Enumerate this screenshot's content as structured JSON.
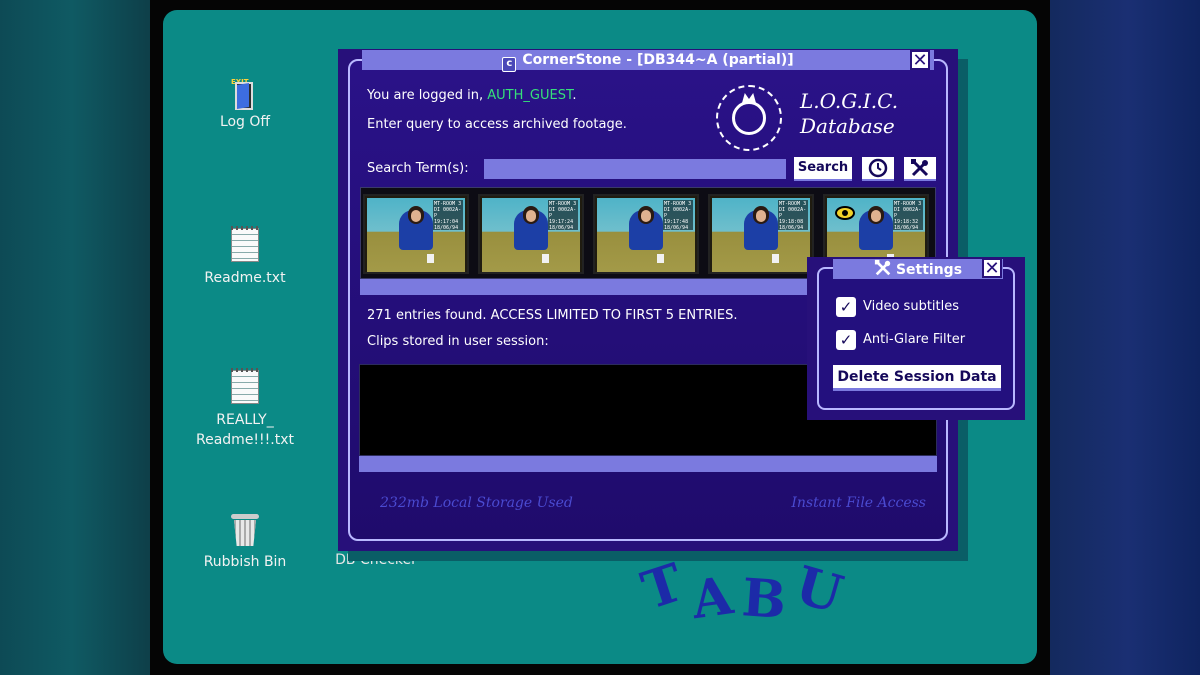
{
  "desktop": {
    "icons": [
      {
        "label": "Log Off",
        "icon": "exit-door-icon",
        "badge": "EXIT"
      },
      {
        "label": "Readme.txt",
        "icon": "notepad-icon"
      },
      {
        "label": "REALLY_",
        "label2": "Readme!!!.txt",
        "icon": "notepad-icon"
      },
      {
        "label": "Rubbish Bin",
        "icon": "trash-bin-icon"
      },
      {
        "label": "DB Checker",
        "icon": "none"
      }
    ],
    "background_text": "TABU"
  },
  "window": {
    "title": "CornerStone - [DB344~A (partial)]",
    "close_glyph": "✕",
    "logged_in_prefix": "You are logged in, ",
    "username": "AUTH_GUEST",
    "logged_in_suffix": ".",
    "instructions": "Enter query to access archived footage.",
    "logo_line1": "L.O.G.I.C.",
    "logo_line2": "Database",
    "search_label": "Search Term(s):",
    "search_value": "",
    "search_button": "Search",
    "results_text": "271 entries found. ACCESS LIMITED TO FIRST 5 ENTRIES.",
    "clips_label": "Clips stored in user session:",
    "storage_text": "232mb Local Storage Used",
    "access_text": "Instant File Access",
    "thumbnails": [
      {
        "stamp": "MT-ROOM 3 DI 0002A-P 19:17:04 18/06/94",
        "viewed": false
      },
      {
        "stamp": "MT-ROOM 3 DI 0002A-P 19:17:24 18/06/94",
        "viewed": false
      },
      {
        "stamp": "MT-ROOM 3 DI 0002A-P 19:17:48 18/06/94",
        "viewed": false
      },
      {
        "stamp": "MT-ROOM 3 DI 0002A-P 19:18:08 18/06/94",
        "viewed": false
      },
      {
        "stamp": "MT-ROOM 3 DI 0002A-P 19:18:32 18/06/94",
        "viewed": true
      }
    ]
  },
  "settings": {
    "title": "Settings",
    "close_glyph": "✕",
    "options": [
      {
        "label": "Video subtitles",
        "checked": true
      },
      {
        "label": "Anti-Glare Filter",
        "checked": true
      }
    ],
    "delete_button": "Delete Session Data"
  },
  "colors": {
    "desktop": "#0b8a86",
    "window": "#27107a",
    "accent": "#7b7adf",
    "username": "#36e07a"
  }
}
